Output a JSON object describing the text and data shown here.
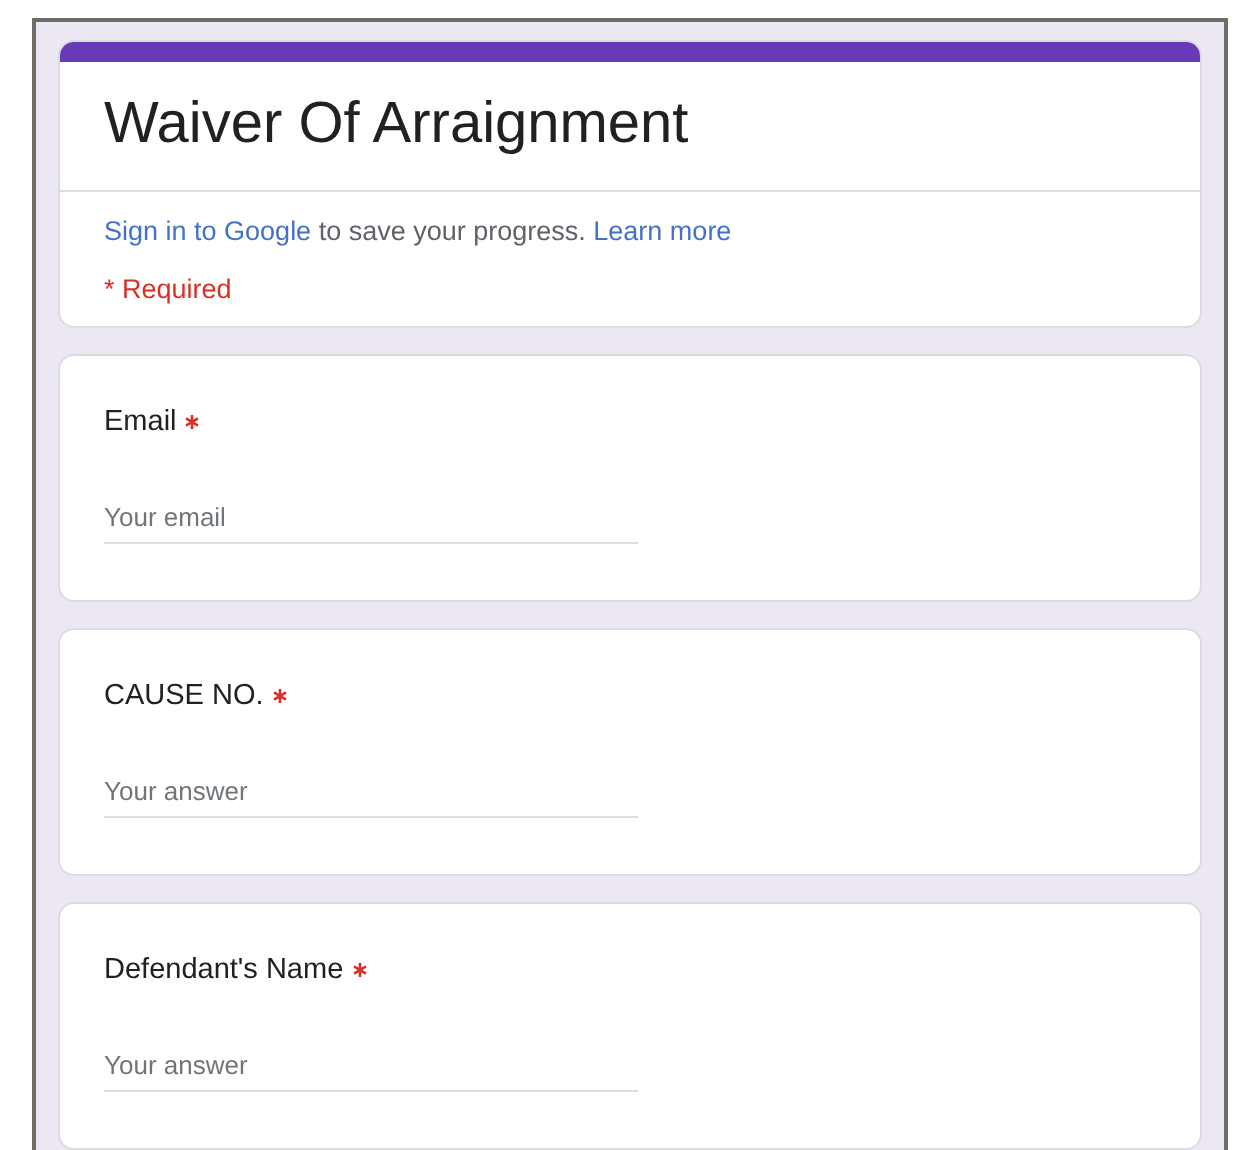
{
  "form": {
    "title": "Waiver Of Arraignment",
    "notice": {
      "sign_in_link": "Sign in to Google",
      "text": "to save your progress.",
      "learn_more_link": "Learn more"
    },
    "required_note": "* Required"
  },
  "questions": [
    {
      "label": "Email",
      "required": true,
      "placeholder": "Your email"
    },
    {
      "label": "CAUSE NO.",
      "required": true,
      "placeholder": "Your answer"
    },
    {
      "label": "Defendant's Name",
      "required": true,
      "placeholder": "Your answer"
    }
  ]
}
